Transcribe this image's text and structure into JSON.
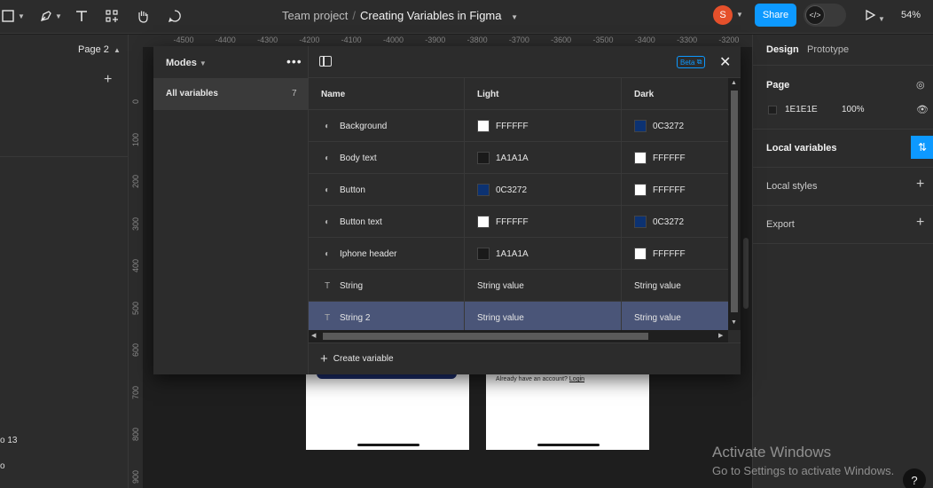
{
  "toolbar": {
    "breadcrumb_project": "Team project",
    "breadcrumb_separator": "/",
    "file_name": "Creating Variables in Figma",
    "avatar_initial": "S",
    "share_label": "Share",
    "zoom": "54%"
  },
  "left_panel": {
    "page_selector": "Page 2",
    "fragment_1": "o 13",
    "fragment_2": "o"
  },
  "ruler": {
    "top_ticks": [
      "-4500",
      "-4400",
      "-4300",
      "-4200",
      "-4100",
      "-4000",
      "-3900",
      "-3800",
      "-3700",
      "-3600",
      "-3500",
      "-3400",
      "-3300",
      "-3200"
    ],
    "left_ticks": [
      "0",
      "100",
      "200",
      "300",
      "400",
      "500",
      "600",
      "700",
      "800",
      "900"
    ]
  },
  "canvas": {
    "login_prompt": "Already have an account?",
    "login_link": "Login"
  },
  "right_panel": {
    "tab_design": "Design",
    "tab_prototype": "Prototype",
    "page_title": "Page",
    "page_color_hex": "1E1E1E",
    "page_opacity": "100%",
    "local_variables": "Local variables",
    "local_styles": "Local styles",
    "export": "Export"
  },
  "variables_modal": {
    "modes_label": "Modes",
    "collection_name": "All variables",
    "collection_count": "7",
    "beta_label": "Beta",
    "columns": [
      "Name",
      "Light",
      "Dark"
    ],
    "rows": [
      {
        "type": "color",
        "name": "Background",
        "light": "FFFFFF",
        "light_color": "#FFFFFF",
        "dark": "0C3272",
        "dark_color": "#0C3272"
      },
      {
        "type": "color",
        "name": "Body text",
        "light": "1A1A1A",
        "light_color": "#1A1A1A",
        "dark": "FFFFFF",
        "dark_color": "#FFFFFF"
      },
      {
        "type": "color",
        "name": "Button",
        "light": "0C3272",
        "light_color": "#0C3272",
        "dark": "FFFFFF",
        "dark_color": "#FFFFFF"
      },
      {
        "type": "color",
        "name": "Button text",
        "light": "FFFFFF",
        "light_color": "#FFFFFF",
        "dark": "0C3272",
        "dark_color": "#0C3272"
      },
      {
        "type": "color",
        "name": "Iphone header",
        "light": "1A1A1A",
        "light_color": "#1A1A1A",
        "dark": "FFFFFF",
        "dark_color": "#FFFFFF"
      },
      {
        "type": "string",
        "name": "String",
        "light": "String value",
        "dark": "String value"
      },
      {
        "type": "string",
        "name": "String 2",
        "light": "String value",
        "dark": "String value",
        "selected": true
      }
    ],
    "create_variable_label": "Create variable"
  },
  "windows_watermark": {
    "title": "Activate Windows",
    "subtitle": "Go to Settings to activate Windows."
  },
  "help_label": "?",
  "colors": {
    "accent": "#0D99FF",
    "selected_row": "#4A5578",
    "avatar": "#E5502B"
  }
}
